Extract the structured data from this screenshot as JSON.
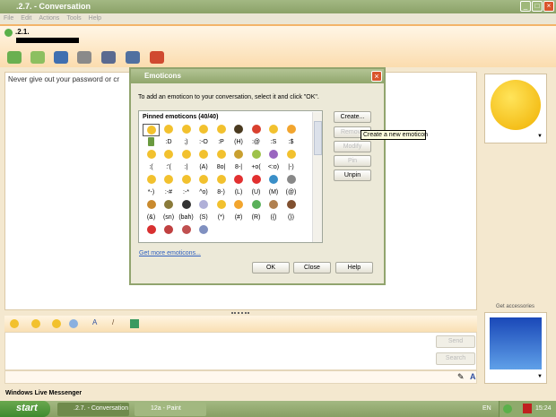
{
  "window": {
    "title": ".2.7. - Conversation",
    "menu": [
      "File",
      "Edit",
      "Actions",
      "Tools",
      "Help"
    ]
  },
  "contact": {
    "name": ".2.1."
  },
  "chat": {
    "warning": "Never give out your password or cr"
  },
  "input": {
    "send": "Send",
    "search": "Search"
  },
  "status": "Windows Live Messenger",
  "right": {
    "get_accessories": "Get accessories"
  },
  "dialog": {
    "title": "Emoticons",
    "instruction": "To add an emoticon to your conversation, select it and click \"OK\".",
    "list_header": "Pinned emoticons (40/40)",
    "buttons": {
      "create": "Create...",
      "remove": "Remove",
      "modify": "Modify",
      "pin": "Pin",
      "unpin": "Unpin"
    },
    "tooltip": "Create a new emoticon",
    "link": "Get more emoticons...",
    "ok": "OK",
    "close": "Close",
    "help": "Help",
    "rows": [
      {
        "codes": [
          "",
          ":D",
          ";)",
          ":-O",
          ":P",
          "(H)",
          ":@",
          ":S",
          ":$"
        ],
        "colors": [
          "#f2c12e",
          "#f2c12e",
          "#f2c12e",
          "#f2c12e",
          "#f2c12e",
          "#4a3a20",
          "#d9402e",
          "#f2c12e",
          "#f2a52e"
        ]
      },
      {
        "codes": [
          ":(",
          ":'(",
          ":|",
          "(A)",
          "8o|",
          "8-|",
          "+o(",
          "<:o)",
          "|-)"
        ],
        "colors": [
          "#f2c12e",
          "#f2c12e",
          "#f2c12e",
          "#f2c12e",
          "#f2c12e",
          "#c9a030",
          "#9ec24a",
          "#9a66c0",
          "#f2c12e"
        ]
      },
      {
        "codes": [
          "*-)",
          ":-#",
          ":-*",
          "^o)",
          "8-)",
          "(L)",
          "(U)",
          "(M)",
          "(@)"
        ],
        "colors": [
          "#f2c12e",
          "#f2c12e",
          "#f2c12e",
          "#f2c12e",
          "#f2c12e",
          "#e23030",
          "#e23030",
          "#3a8fc8",
          "#888"
        ]
      },
      {
        "codes": [
          "(&)",
          "(sn)",
          "(bah)",
          "(S)",
          "(*)",
          "(#)",
          "(R)",
          "({)",
          "(})"
        ],
        "colors": [
          "#c98a2e",
          "#8a7a3a",
          "#333",
          "#b0b0d8",
          "#f2c12e",
          "#f2a52e",
          "#5ab05a",
          "#b08050",
          "#805030"
        ]
      },
      {
        "codes": [],
        "colors": [
          "#d83030",
          "#c04040",
          "#c05050",
          "#8090c0"
        ]
      }
    ]
  },
  "taskbar": {
    "start": "start",
    "tasks": [
      ".2.7. - Conversation",
      "12a - Paint"
    ],
    "lang": "EN",
    "clock": "15:24"
  }
}
